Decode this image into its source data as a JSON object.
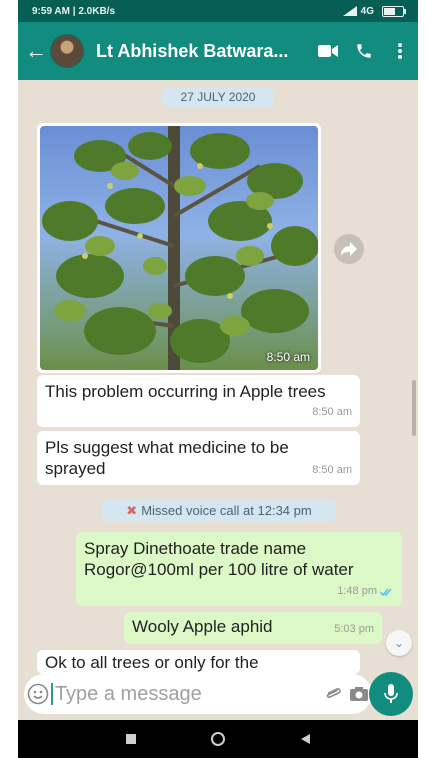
{
  "status_bar": {
    "time_speed": "9:59 AM | 2.0KB/s",
    "network": "4G",
    "signal": "",
    "battery": 0.7
  },
  "header": {
    "contact_name": "Lt Abhishek Batwara..."
  },
  "chat": {
    "date_label": "27 JULY 2020",
    "image_message": {
      "time": "8:50 am"
    },
    "messages": [
      {
        "text": "This problem occurring in Apple trees",
        "time": "8:50 am",
        "direction": "in"
      },
      {
        "text": "Pls suggest what medicine to be sprayed",
        "time": "8:50 am",
        "direction": "in"
      }
    ],
    "missed_call": "Missed voice call at 12:34 pm",
    "outgoing": [
      {
        "text": "Spray Dinethoate trade name Rogor@100ml per 100 litre of water",
        "time": "1:48 pm"
      },
      {
        "text": "Wooly Apple aphid",
        "time": "5:03 pm"
      }
    ],
    "partial_message": "Ok to all trees or only for the"
  },
  "composer": {
    "placeholder": "Type a message"
  },
  "colors": {
    "header": "#128c7e",
    "status": "#075e54",
    "outgoing_bubble": "#dcf8c6",
    "chat_bg": "#e7dfd4"
  },
  "icons": [
    "back-arrow-icon",
    "video-call-icon",
    "phone-icon",
    "more-vert-icon",
    "forward-icon",
    "emoji-icon",
    "attach-icon",
    "camera-icon",
    "mic-icon",
    "double-check-icon"
  ]
}
